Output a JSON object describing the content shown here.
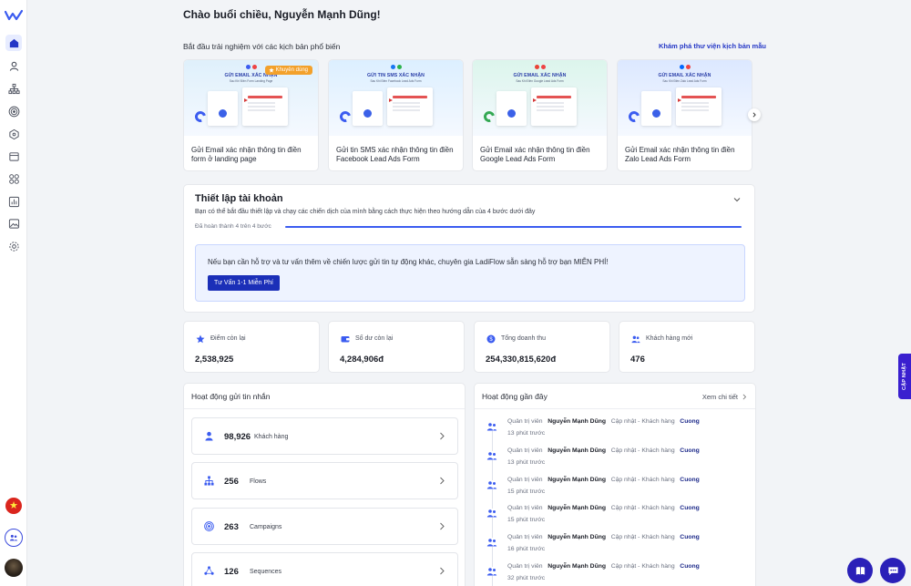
{
  "greeting": "Chào buổi chiều, Nguyễn Mạnh Dũng!",
  "templates_section": {
    "title": "Bắt đầu trải nghiệm với các kịch bản phổ biến",
    "link": "Khám phá thư viện kịch bản mẫu",
    "badge": "Khuyên dùng",
    "cards": [
      {
        "thumb_title": "GỬI EMAIL XÁC NHẬN",
        "thumb_sub": "Sau Khi Điền Form Landing Page",
        "name": "Gửi Email xác nhận thông tin điền form ở landing page",
        "bg": "#dff0fb"
      },
      {
        "thumb_title": "GỬI TIN SMS XÁC NHẬN",
        "thumb_sub": "Sau Khi Điền Facebook Lead Ads Form",
        "name": "Gửi tin SMS xác nhận thông tin điền Facebook Lead Ads Form",
        "bg": "#dcefff"
      },
      {
        "thumb_title": "GỬI EMAIL XÁC NHẬN",
        "thumb_sub": "Sau Khi Điền Google Lead Ads Form",
        "name": "Gửi Email xác nhận thông tin điền Google Lead Ads Form",
        "bg": "#dcf5ec"
      },
      {
        "thumb_title": "GỬI EMAIL XÁC NHẬN",
        "thumb_sub": "Sau Khi Điền Zalo Lead Ads Form",
        "name": "Gửi Email xác nhận thông tin điền Zalo Lead Ads Form",
        "bg": "#dce8ff"
      }
    ]
  },
  "setup": {
    "title": "Thiết lập tài khoản",
    "description": "Bạn có thể bắt đầu thiết lập và chạy các chiến dịch của mình bằng cách thực hiện theo hướng dẫn của 4 bước dưới đây",
    "progress_label": "Đã hoàn thành 4 trên 4 bước",
    "progress": 1.0,
    "support_text": "Nếu bạn cần hỗ trợ và tư vấn thêm về chiến lược gửi tin tự động khác, chuyên gia LadiFlow sẵn sàng hỗ trợ bạn MIỄN PHÍ!",
    "consult_button": "Tư Vấn 1-1 Miễn Phí"
  },
  "stats": [
    {
      "label": "Điểm còn lại",
      "value": "2,538,925",
      "icon": "star-icon"
    },
    {
      "label": "Số dư còn lại",
      "value": "4,284,906đ",
      "icon": "wallet-icon"
    },
    {
      "label": "Tổng doanh thu",
      "value": "254,330,815,620đ",
      "icon": "dollar-icon"
    },
    {
      "label": "Khách hàng mới",
      "value": "476",
      "icon": "users-icon"
    }
  ],
  "messaging": {
    "title": "Hoạt động gửi tin nhắn",
    "rows": [
      {
        "count": "98,926",
        "label": "Khách hàng"
      },
      {
        "count": "256",
        "label": "Flows"
      },
      {
        "count": "263",
        "label": "Campaigns"
      },
      {
        "count": "126",
        "label": "Sequences"
      }
    ]
  },
  "recent": {
    "title": "Hoạt động gần đây",
    "see_detail": "Xem chi tiết",
    "items": [
      {
        "role": "Quản trị viên",
        "user": "Nguyễn Mạnh Dũng",
        "action": "Cập nhật - Khách hàng",
        "target": "Cuong",
        "time": "13 phút trước"
      },
      {
        "role": "Quản trị viên",
        "user": "Nguyễn Mạnh Dũng",
        "action": "Cập nhật - Khách hàng",
        "target": "Cuong",
        "time": "13 phút trước"
      },
      {
        "role": "Quản trị viên",
        "user": "Nguyễn Mạnh Dũng",
        "action": "Cập nhật - Khách hàng",
        "target": "Cuong",
        "time": "15 phút trước"
      },
      {
        "role": "Quản trị viên",
        "user": "Nguyễn Mạnh Dũng",
        "action": "Cập nhật - Khách hàng",
        "target": "Cuong",
        "time": "15 phút trước"
      },
      {
        "role": "Quản trị viên",
        "user": "Nguyễn Mạnh Dũng",
        "action": "Cập nhật - Khách hàng",
        "target": "Cuong",
        "time": "16 phút trước"
      },
      {
        "role": "Quản trị viên",
        "user": "Nguyễn Mạnh Dũng",
        "action": "Cập nhật - Khách hàng",
        "target": "Cuong",
        "time": "32 phút trước"
      }
    ]
  },
  "update_tab": "CẬP NHẬT",
  "colors": {
    "accent": "#2437c6",
    "primary_button": "#1b2fb8",
    "badge": "#f3a12b",
    "update_tab": "#3a1fcf"
  }
}
